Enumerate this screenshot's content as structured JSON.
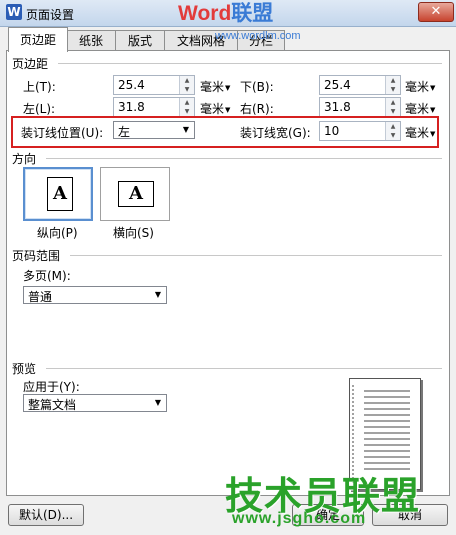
{
  "window": {
    "title": "页面设置",
    "close": "✕"
  },
  "watermark": {
    "brand_part1": "Word",
    "brand_part2": "联盟",
    "url": "www.wordlm.com",
    "big_text": "技术员联盟",
    "big_url": "www.jsgho.com"
  },
  "tabs": [
    {
      "label": "页边距"
    },
    {
      "label": "纸张"
    },
    {
      "label": "版式"
    },
    {
      "label": "文档网格"
    },
    {
      "label": "分栏"
    }
  ],
  "margins": {
    "section_title": "页边距",
    "top": {
      "label": "上(T):",
      "value": "25.4",
      "unit": "毫米"
    },
    "bottom": {
      "label": "下(B):",
      "value": "25.4",
      "unit": "毫米"
    },
    "left": {
      "label": "左(L):",
      "value": "31.8",
      "unit": "毫米"
    },
    "right": {
      "label": "右(R):",
      "value": "31.8",
      "unit": "毫米"
    },
    "gutter_pos": {
      "label": "装订线位置(U):",
      "value": "左"
    },
    "gutter_width": {
      "label": "装订线宽(G):",
      "value": "10",
      "unit": "毫米"
    }
  },
  "orientation": {
    "section_title": "方向",
    "glyph": "A",
    "portrait": "纵向(P)",
    "landscape": "横向(S)",
    "selected": "portrait"
  },
  "pages": {
    "section_title": "页码范围",
    "multi_label": "多页(M):",
    "multi_value": "普通"
  },
  "preview": {
    "section_title": "预览",
    "apply_label": "应用于(Y):",
    "apply_value": "整篇文档"
  },
  "footer": {
    "default_button": "默认(D)...",
    "ok_button": "确定",
    "cancel_button": "取消"
  },
  "colors": {
    "highlight_border": "#d62020",
    "watermark_green": "#2aa22a"
  }
}
